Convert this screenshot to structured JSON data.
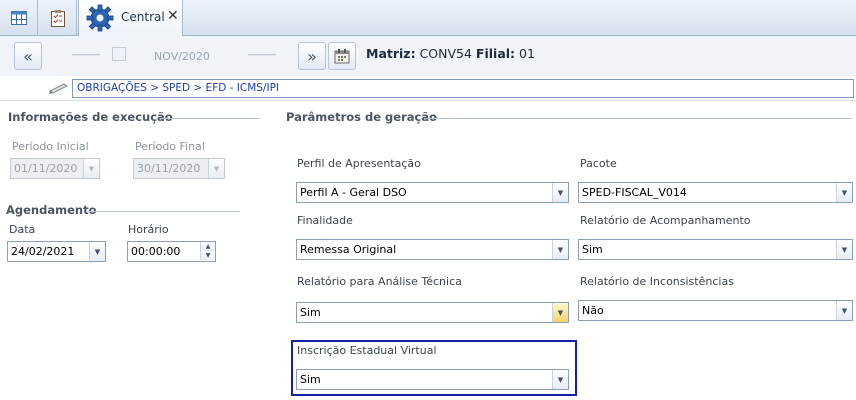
{
  "tabs": {
    "central_label": "Central",
    "close_glyph": "✕"
  },
  "toolbar": {
    "prev_glyph": "«",
    "next_glyph": "»",
    "period_ghost": "NOV/2020",
    "matriz_label": "Matriz:",
    "matriz_value": "CONV54",
    "filial_label": "Filial:",
    "filial_value": "01"
  },
  "breadcrumb": "OBRIGAÇÕES > SPED > EFD - ICMS/IPI",
  "execucao": {
    "title": "Informações de execução",
    "periodo_inicial_label": "Período  Inicial",
    "periodo_inicial_value": "01/11/2020",
    "periodo_final_label": "Período Final",
    "periodo_final_value": "30/11/2020"
  },
  "agendamento": {
    "title": "Agendamento",
    "data_label": "Data",
    "data_value": "24/02/2021",
    "horario_label": "Horário",
    "horario_value": "00:00:00"
  },
  "parametros": {
    "title": "Parâmetros de geração",
    "perfil_label": "Perfil de Apresentação",
    "perfil_value": "Perfil A - Geral DSO",
    "pacote_label": "Pacote",
    "pacote_value": "SPED-FISCAL_V014",
    "finalidade_label": "Finalidade",
    "finalidade_value": "Remessa Original",
    "acompanhamento_label": "Relatório de Acompanhamento",
    "acompanhamento_value": "Sim",
    "analise_label": "Relatório para Análise Técnica",
    "analise_value": "Sim",
    "inconsistencias_label": "Relatório de Inconsistências",
    "inconsistencias_value": "Não",
    "ie_virtual_label": "Inscrição Estadual Virtual",
    "ie_virtual_value": "Sim"
  },
  "icons": [
    "grid-icon",
    "checklist-icon",
    "gear-icon",
    "calendar-icon",
    "pen-icon"
  ],
  "colors": {
    "highlight_border": "#1620a6",
    "link_blue": "#1f3fa8",
    "accent_arrow": "#f3d56c"
  }
}
